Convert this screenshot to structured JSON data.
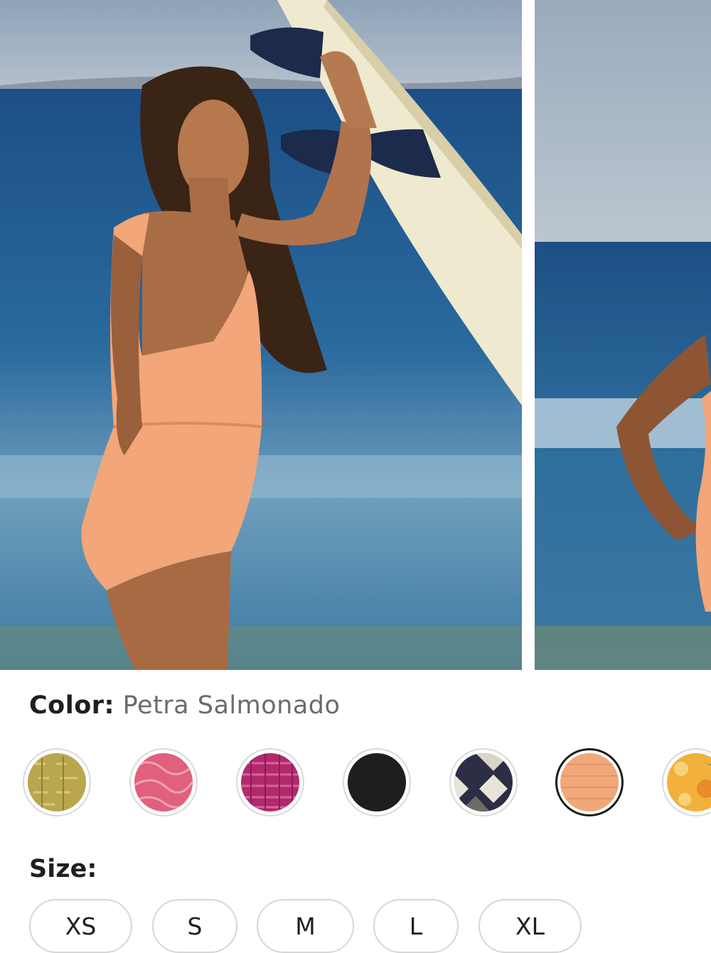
{
  "gallery": {
    "images": [
      {
        "icon": "model-surfboard-photo"
      },
      {
        "icon": "model-beach-photo"
      }
    ]
  },
  "color": {
    "label": "Color:",
    "selected_value": "Petra Salmonado",
    "swatches": [
      {
        "icon": "gold-textured-swatch",
        "color": "#b9a64e"
      },
      {
        "icon": "pink-marble-swatch",
        "color": "#e0607d"
      },
      {
        "icon": "magenta-textured-swatch",
        "color": "#b02a6c"
      },
      {
        "icon": "black-swatch",
        "color": "#1e1e1e"
      },
      {
        "icon": "navy-pattern-swatch",
        "color": "#2b2e45"
      },
      {
        "icon": "salmon-swatch",
        "color": "#f0a87a",
        "selected": true
      },
      {
        "icon": "floral-swatch",
        "color": "#f2b13c"
      }
    ]
  },
  "size": {
    "label": "Size:",
    "options": [
      "XS",
      "S",
      "M",
      "L",
      "XL"
    ]
  }
}
